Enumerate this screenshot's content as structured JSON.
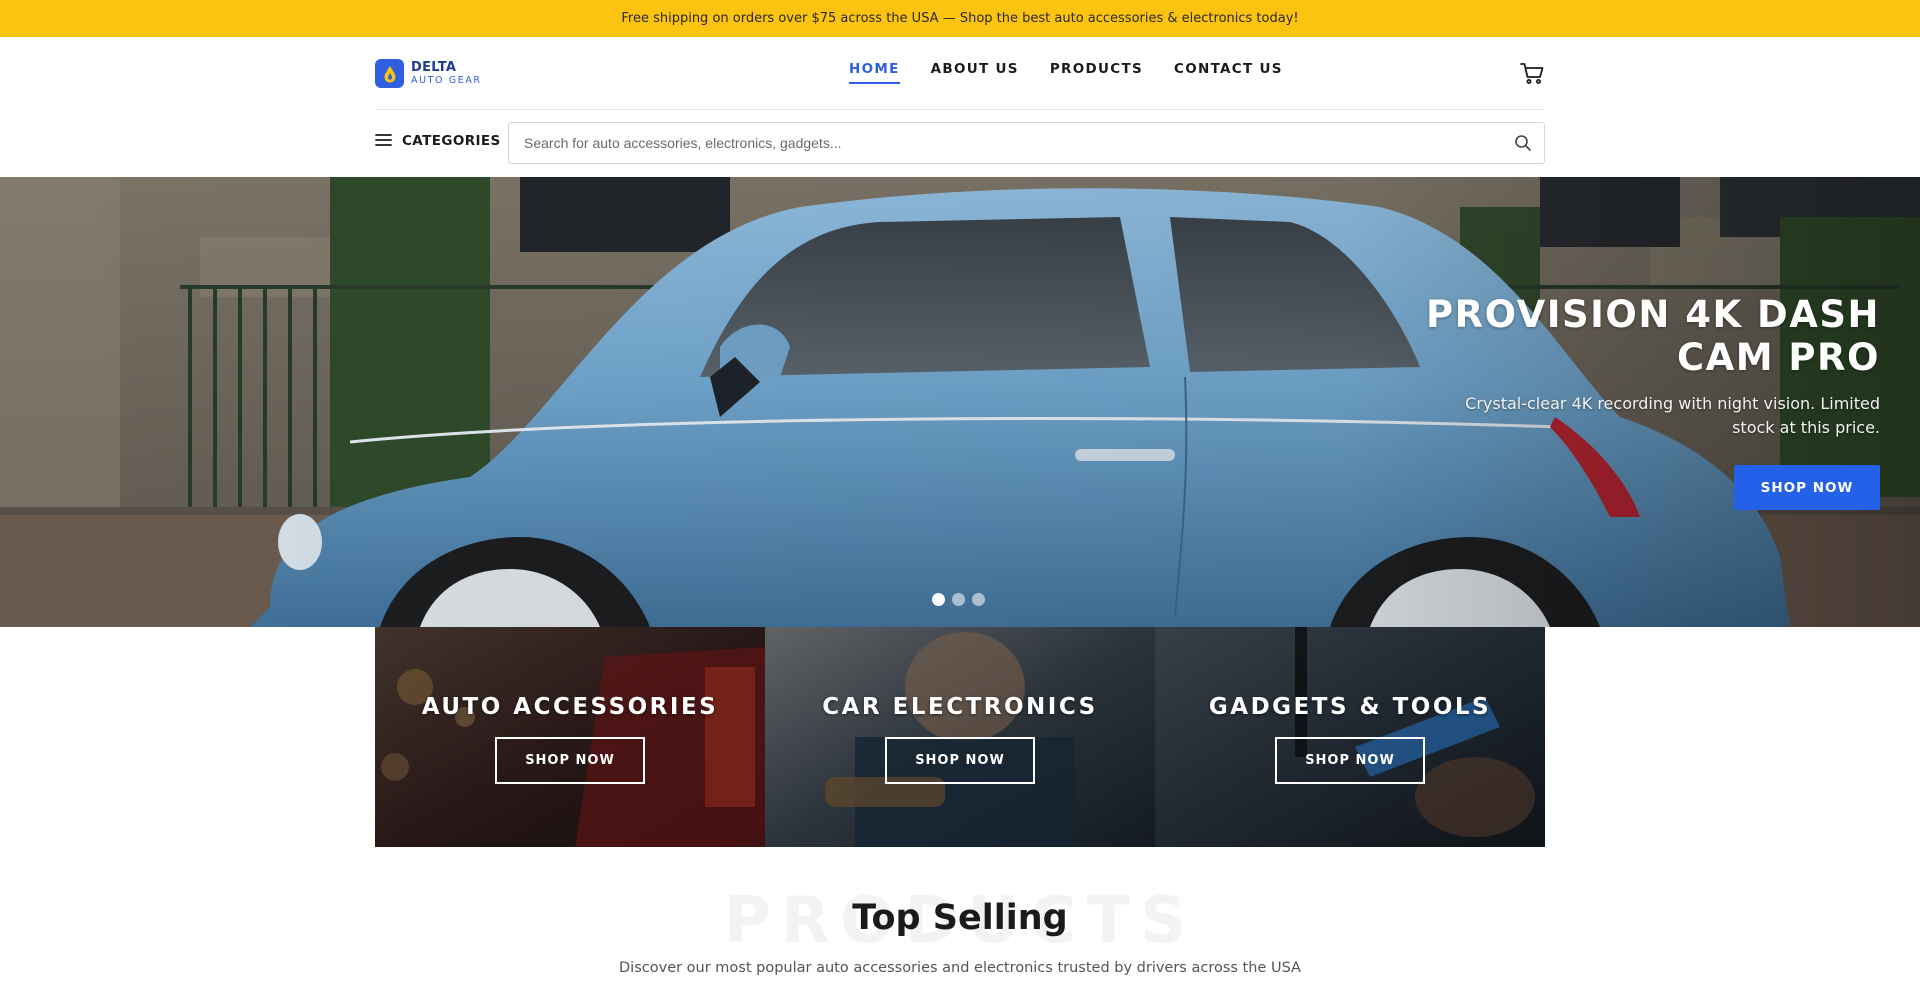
{
  "announcement": "Free shipping on orders over $75 across the USA — Shop the best auto accessories & electronics today!",
  "brand": {
    "name": "DELTA",
    "tagline": "AUTO GEAR",
    "icon": "droplet-flame-icon",
    "color": "#2f5fe0"
  },
  "nav": {
    "items": [
      {
        "label": "HOME",
        "active": true
      },
      {
        "label": "ABOUT US",
        "active": false
      },
      {
        "label": "PRODUCTS",
        "active": false
      },
      {
        "label": "CONTACT US",
        "active": false
      }
    ],
    "cart_icon": "cart-icon"
  },
  "search": {
    "categories_label": "CATEGORIES",
    "menu_icon": "hamburger-icon",
    "placeholder": "Search for auto accessories, electronics, gadgets...",
    "value": "",
    "search_icon": "search-icon"
  },
  "hero": {
    "title": "PROVISION 4K DASH CAM PRO",
    "description": "Crystal-clear 4K recording with night vision. Limited stock at this price.",
    "button_label": "SHOP NOW",
    "slides": 3,
    "active_slide": 1,
    "accent": "#2561e8"
  },
  "categories": [
    {
      "title": "AUTO ACCESSORIES",
      "button_label": "SHOP NOW"
    },
    {
      "title": "CAR ELECTRONICS",
      "button_label": "SHOP NOW"
    },
    {
      "title": "GADGETS & TOOLS",
      "button_label": "SHOP NOW"
    }
  ],
  "section": {
    "watermark": "PRODUCTS",
    "title": "Top Selling",
    "subtitle": "Discover our most popular auto accessories and electronics trusted by drivers across the USA"
  }
}
